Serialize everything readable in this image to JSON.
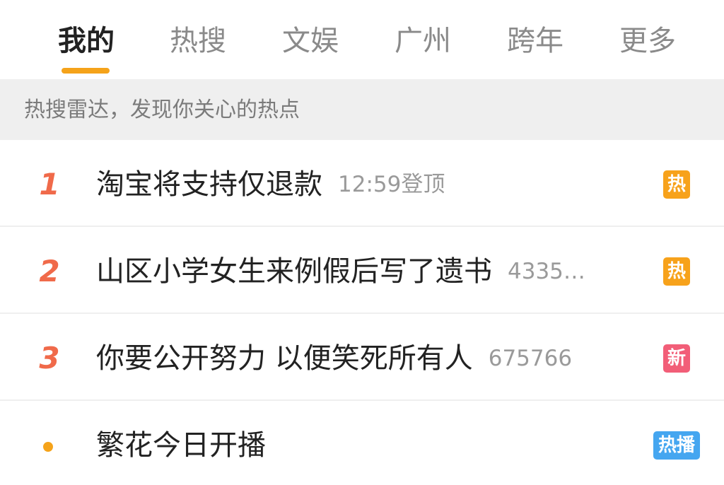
{
  "tabs": [
    {
      "label": "我的",
      "active": true
    },
    {
      "label": "热搜",
      "active": false
    },
    {
      "label": "文娱",
      "active": false
    },
    {
      "label": "广州",
      "active": false
    },
    {
      "label": "跨年",
      "active": false
    },
    {
      "label": "更多",
      "active": false
    }
  ],
  "banner": {
    "text": "热搜雷达，发现你关心的热点"
  },
  "items": [
    {
      "rank": "1",
      "title": "淘宝将支持仅退款",
      "meta": "12:59登顶",
      "badge": "热"
    },
    {
      "rank": "2",
      "title": "山区小学女生来例假后写了遗书",
      "meta": "4335…",
      "badge": "热"
    },
    {
      "rank": "3",
      "title": "你要公开努力 以便笑死所有人",
      "meta": "675766",
      "badge": "新"
    },
    {
      "rank": "",
      "title": "繁花今日开播",
      "meta": "",
      "badge": "热播"
    }
  ],
  "colors": {
    "accent": "#f5a31a",
    "rank": "#f06a4a",
    "badge_hot": "#f7a21b",
    "badge_new": "#f25e78",
    "badge_live": "#45a6f0",
    "dot": "#f5a31a"
  }
}
